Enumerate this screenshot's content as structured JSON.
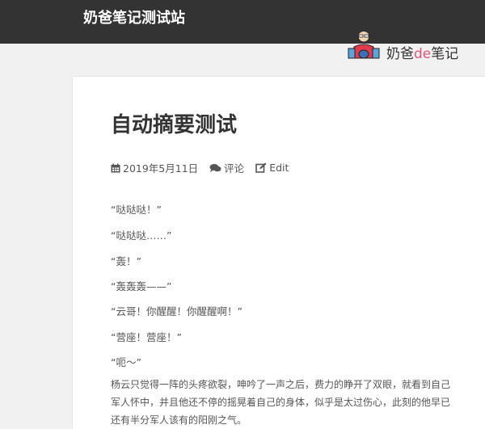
{
  "header": {
    "site_title": "奶爸笔记测试站",
    "logo": {
      "text_a": "奶爸",
      "text_de": "de",
      "text_b": "笔记",
      "accent": "#e2557a"
    }
  },
  "post": {
    "title": "自动摘要测试",
    "meta": {
      "date": "2019年5月11日",
      "comments": "评论",
      "edit": "Edit"
    },
    "dialogue": [
      "“哒哒哒！”",
      "“哒哒哒……”",
      "“轰！”",
      "“轰轰轰——”",
      "“云哥！你醒醒！你醒醒啊！”",
      "“营座！营座！”",
      "“呃～”"
    ],
    "paragraph_lines": [
      "杨云只觉得一阵的头疼欲裂，呻吟了一声之后，费力的睁开了双眼，就看到自己",
      "军人怀中，并且他还不停的摇晃着自己的身体，似乎是太过伤心，此刻的他早已",
      "还有半分军人该有的阳刚之气。"
    ]
  }
}
